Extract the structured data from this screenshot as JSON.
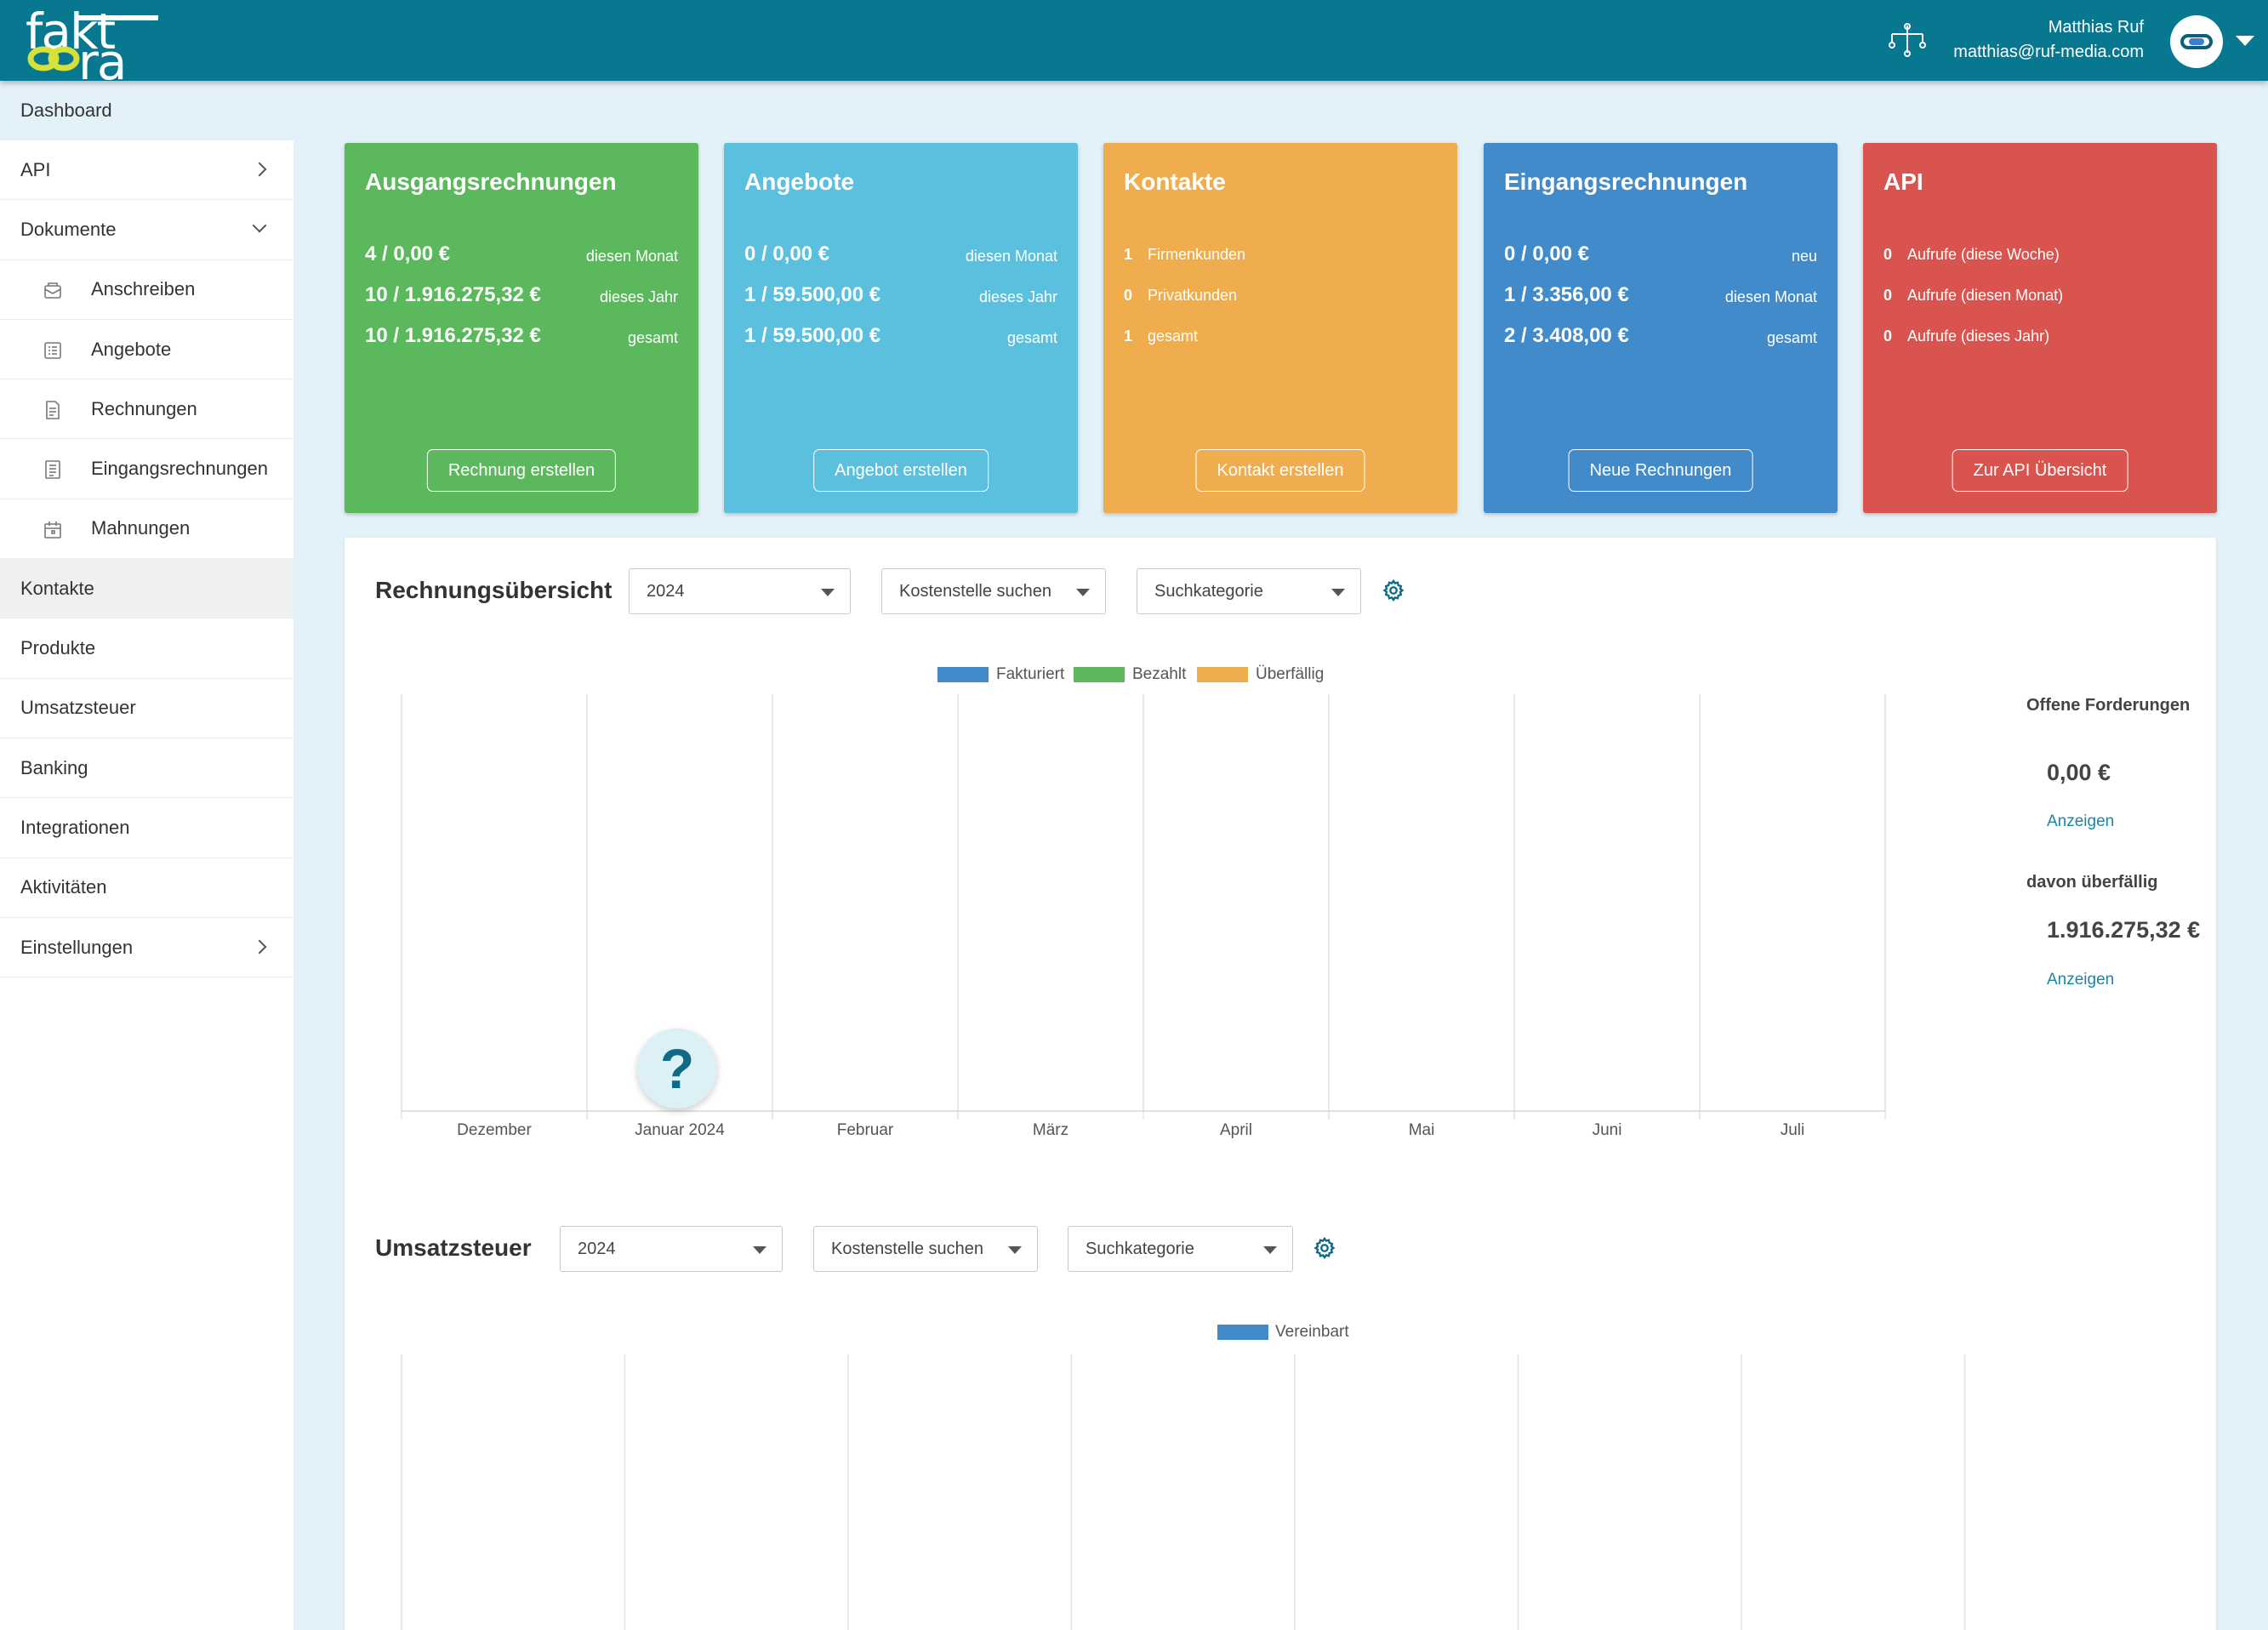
{
  "header": {
    "logo_top": "fakt",
    "logo_bottom": "ra",
    "user_name": "Matthias Ruf",
    "user_email": "matthias@ruf-media.com"
  },
  "breadcrumb": "Dashboard",
  "sidebar": {
    "items": [
      {
        "label": "API"
      },
      {
        "label": "Dokumente"
      },
      {
        "label": "Anschreiben"
      },
      {
        "label": "Angebote"
      },
      {
        "label": "Rechnungen"
      },
      {
        "label": "Eingangsrechnungen"
      },
      {
        "label": "Mahnungen"
      },
      {
        "label": "Kontakte"
      },
      {
        "label": "Produkte"
      },
      {
        "label": "Umsatzsteuer"
      },
      {
        "label": "Banking"
      },
      {
        "label": "Integrationen"
      },
      {
        "label": "Aktivitäten"
      },
      {
        "label": "Einstellungen"
      }
    ]
  },
  "cards": [
    {
      "title": "Ausgangsrechnungen",
      "color": "#5cb85c",
      "rows": [
        {
          "value": "4 / 0,00 €",
          "label": "diesen Monat"
        },
        {
          "value": "10 / 1.916.275,32 €",
          "label": "dieses Jahr"
        },
        {
          "value": "10 / 1.916.275,32 €",
          "label": "gesamt"
        }
      ],
      "button": "Rechnung erstellen"
    },
    {
      "title": "Angebote",
      "color": "#5bc0de",
      "rows": [
        {
          "value": "0 / 0,00 €",
          "label": "diesen Monat"
        },
        {
          "value": "1 / 59.500,00 €",
          "label": "dieses Jahr"
        },
        {
          "value": "1 / 59.500,00 €",
          "label": "gesamt"
        }
      ],
      "button": "Angebot erstellen"
    },
    {
      "title": "Kontakte",
      "color": "#f0ad4e",
      "rows": [
        {
          "num": "1",
          "text": "Firmenkunden"
        },
        {
          "num": "0",
          "text": "Privatkunden"
        },
        {
          "num": "1",
          "text": "gesamt"
        }
      ],
      "button": "Kontakt erstellen"
    },
    {
      "title": "Eingangsrechnungen",
      "color": "#428bca",
      "rows": [
        {
          "value": "0 / 0,00 €",
          "label": "neu"
        },
        {
          "value": "1 / 3.356,00 €",
          "label": "diesen Monat"
        },
        {
          "value": "2 / 3.408,00 €",
          "label": "gesamt"
        }
      ],
      "button": "Neue Rechnungen"
    },
    {
      "title": "API",
      "color": "#d9534f",
      "rows": [
        {
          "num": "0",
          "text": "Aufrufe (diese Woche)"
        },
        {
          "num": "0",
          "text": "Aufrufe (diesen Monat)"
        },
        {
          "num": "0",
          "text": "Aufrufe (dieses Jahr)"
        }
      ],
      "button": "Zur API Übersicht"
    }
  ],
  "invoice_overview": {
    "title": "Rechnungsübersicht",
    "year": "2024",
    "cost_center_placeholder": "Kostenstelle suchen",
    "category_placeholder": "Suchkategorie",
    "open_claims_label": "Offene Forderungen",
    "open_claims_value": "0,00 €",
    "show_link_1": "Anzeigen",
    "overdue_label": "davon überfällig",
    "overdue_value": "1.916.275,32 €",
    "show_link_2": "Anzeigen"
  },
  "vat": {
    "title": "Umsatzsteuer",
    "year": "2024",
    "cost_center_placeholder": "Kostenstelle suchen",
    "category_placeholder": "Suchkategorie"
  },
  "help": {
    "symbol": "?"
  },
  "chart_data": [
    {
      "type": "bar",
      "categories": [
        "Dezember",
        "Januar 2024",
        "Februar",
        "März",
        "April",
        "Mai",
        "Juni",
        "Juli"
      ],
      "series": [
        {
          "name": "Fakturiert",
          "color": "#428bca",
          "values": [
            0,
            0,
            0,
            0,
            0,
            0,
            0,
            0
          ]
        },
        {
          "name": "Bezahlt",
          "color": "#5cb85c",
          "values": [
            0,
            0,
            0,
            0,
            0,
            0,
            0,
            0
          ]
        },
        {
          "name": "Überfällig",
          "color": "#f0ad4e",
          "values": [
            0,
            0,
            0,
            0,
            0,
            0,
            0,
            0
          ]
        }
      ],
      "grid": true,
      "legend": "top-center"
    },
    {
      "type": "bar",
      "categories": [],
      "series": [
        {
          "name": "Vereinbart",
          "color": "#428bca",
          "values": []
        }
      ],
      "grid": true,
      "legend": "top-center"
    }
  ]
}
